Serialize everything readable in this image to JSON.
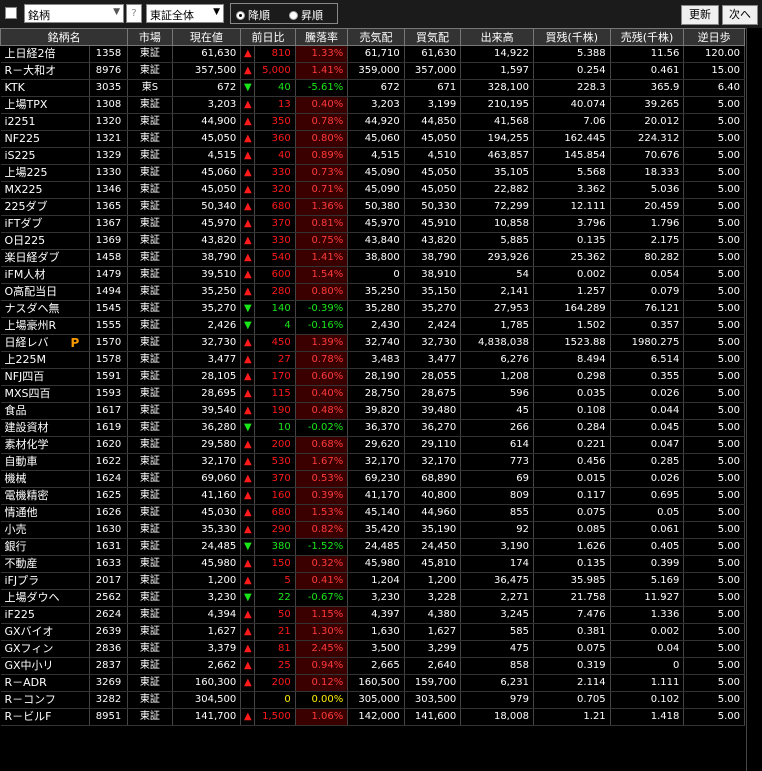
{
  "toolbar": {
    "combo_label": "銘柄",
    "help": "?",
    "market_filter": "東証全体",
    "radio_desc": "降順",
    "radio_asc": "昇順",
    "refresh": "更新",
    "next": "次へ"
  },
  "columns": [
    "銘柄名",
    "市場",
    "現在値",
    "前日比",
    "騰落率",
    "売気配",
    "買気配",
    "出来高",
    "買残(千株)",
    "売残(千株)",
    "逆日歩"
  ],
  "rows": [
    {
      "name": "上日経2倍",
      "code": "1358",
      "market": "東証",
      "price": "61,630",
      "dir": "up",
      "change": "810",
      "pct": "1.33%",
      "ask": "61,710",
      "bid": "61,630",
      "volume": "14,922",
      "buy": "5.388",
      "sell": "11.56",
      "rev": "120.00"
    },
    {
      "name": "R－大和オ",
      "code": "8976",
      "market": "東証",
      "price": "357,500",
      "dir": "up",
      "change": "5,000",
      "pct": "1.41%",
      "ask": "359,000",
      "bid": "357,000",
      "volume": "1,597",
      "buy": "0.254",
      "sell": "0.461",
      "rev": "15.00"
    },
    {
      "name": "KTK",
      "code": "3035",
      "market": "東S",
      "price": "672",
      "dir": "dn",
      "change": "40",
      "pct": "-5.61%",
      "ask": "672",
      "bid": "671",
      "volume": "328,100",
      "buy": "228.3",
      "sell": "365.9",
      "rev": "6.40"
    },
    {
      "name": "上場TPX",
      "code": "1308",
      "market": "東証",
      "price": "3,203",
      "dir": "up",
      "change": "13",
      "pct": "0.40%",
      "ask": "3,203",
      "bid": "3,199",
      "volume": "210,195",
      "buy": "40.074",
      "sell": "39.265",
      "rev": "5.00"
    },
    {
      "name": "i2251",
      "code": "1320",
      "market": "東証",
      "price": "44,900",
      "dir": "up",
      "change": "350",
      "pct": "0.78%",
      "ask": "44,920",
      "bid": "44,850",
      "volume": "41,568",
      "buy": "7.06",
      "sell": "20.012",
      "rev": "5.00"
    },
    {
      "name": "NF225",
      "code": "1321",
      "market": "東証",
      "price": "45,050",
      "dir": "up",
      "change": "360",
      "pct": "0.80%",
      "ask": "45,060",
      "bid": "45,050",
      "volume": "194,255",
      "buy": "162.445",
      "sell": "224.312",
      "rev": "5.00"
    },
    {
      "name": "iS225",
      "code": "1329",
      "market": "東証",
      "price": "4,515",
      "dir": "up",
      "change": "40",
      "pct": "0.89%",
      "ask": "4,515",
      "bid": "4,510",
      "volume": "463,857",
      "buy": "145.854",
      "sell": "70.676",
      "rev": "5.00"
    },
    {
      "name": "上場225",
      "code": "1330",
      "market": "東証",
      "price": "45,060",
      "dir": "up",
      "change": "330",
      "pct": "0.73%",
      "ask": "45,090",
      "bid": "45,050",
      "volume": "35,105",
      "buy": "5.568",
      "sell": "18.333",
      "rev": "5.00"
    },
    {
      "name": "MX225",
      "code": "1346",
      "market": "東証",
      "price": "45,050",
      "dir": "up",
      "change": "320",
      "pct": "0.71%",
      "ask": "45,090",
      "bid": "45,050",
      "volume": "22,882",
      "buy": "3.362",
      "sell": "5.036",
      "rev": "5.00"
    },
    {
      "name": "225ダブ",
      "code": "1365",
      "market": "東証",
      "price": "50,340",
      "dir": "up",
      "change": "680",
      "pct": "1.36%",
      "ask": "50,380",
      "bid": "50,330",
      "volume": "72,299",
      "buy": "12.111",
      "sell": "20.459",
      "rev": "5.00"
    },
    {
      "name": "iFTダブ",
      "code": "1367",
      "market": "東証",
      "price": "45,970",
      "dir": "up",
      "change": "370",
      "pct": "0.81%",
      "ask": "45,970",
      "bid": "45,910",
      "volume": "10,858",
      "buy": "3.796",
      "sell": "1.796",
      "rev": "5.00"
    },
    {
      "name": "O日225",
      "code": "1369",
      "market": "東証",
      "price": "43,820",
      "dir": "up",
      "change": "330",
      "pct": "0.75%",
      "ask": "43,840",
      "bid": "43,820",
      "volume": "5,885",
      "buy": "0.135",
      "sell": "2.175",
      "rev": "5.00"
    },
    {
      "name": "楽日経ダブ",
      "code": "1458",
      "market": "東証",
      "price": "38,790",
      "dir": "up",
      "change": "540",
      "pct": "1.41%",
      "ask": "38,800",
      "bid": "38,790",
      "volume": "293,926",
      "buy": "25.362",
      "sell": "80.282",
      "rev": "5.00"
    },
    {
      "name": "iFM人材",
      "code": "1479",
      "market": "東証",
      "price": "39,510",
      "dir": "up",
      "change": "600",
      "pct": "1.54%",
      "ask": "0",
      "bid": "38,910",
      "volume": "54",
      "buy": "0.002",
      "sell": "0.054",
      "rev": "5.00"
    },
    {
      "name": "O高配当日",
      "code": "1494",
      "market": "東証",
      "price": "35,250",
      "dir": "up",
      "change": "280",
      "pct": "0.80%",
      "ask": "35,250",
      "bid": "35,150",
      "volume": "2,141",
      "buy": "1.257",
      "sell": "0.079",
      "rev": "5.00"
    },
    {
      "name": "ナスダヘ無",
      "code": "1545",
      "market": "東証",
      "price": "35,270",
      "dir": "dn",
      "change": "140",
      "pct": "-0.39%",
      "ask": "35,280",
      "bid": "35,270",
      "volume": "27,953",
      "buy": "164.289",
      "sell": "76.121",
      "rev": "5.00"
    },
    {
      "name": "上場豪州R",
      "code": "1555",
      "market": "東証",
      "price": "2,426",
      "dir": "dn",
      "change": "4",
      "pct": "-0.16%",
      "ask": "2,430",
      "bid": "2,424",
      "volume": "1,785",
      "buy": "1.502",
      "sell": "0.357",
      "rev": "5.00"
    },
    {
      "name": "日経レバ",
      "code": "1570",
      "market": "東証",
      "price": "32,730",
      "dir": "up",
      "change": "450",
      "pct": "1.39%",
      "ask": "32,740",
      "bid": "32,730",
      "volume": "4,838,038",
      "buy": "1523.88",
      "sell": "1980.275",
      "rev": "5.00",
      "mark": "P"
    },
    {
      "name": "上225M",
      "code": "1578",
      "market": "東証",
      "price": "3,477",
      "dir": "up",
      "change": "27",
      "pct": "0.78%",
      "ask": "3,483",
      "bid": "3,477",
      "volume": "6,276",
      "buy": "8.494",
      "sell": "6.514",
      "rev": "5.00"
    },
    {
      "name": "NFJ四百",
      "code": "1591",
      "market": "東証",
      "price": "28,105",
      "dir": "up",
      "change": "170",
      "pct": "0.60%",
      "ask": "28,190",
      "bid": "28,055",
      "volume": "1,208",
      "buy": "0.298",
      "sell": "0.355",
      "rev": "5.00"
    },
    {
      "name": "MXS四百",
      "code": "1593",
      "market": "東証",
      "price": "28,695",
      "dir": "up",
      "change": "115",
      "pct": "0.40%",
      "ask": "28,750",
      "bid": "28,675",
      "volume": "596",
      "buy": "0.035",
      "sell": "0.026",
      "rev": "5.00"
    },
    {
      "name": "食品",
      "code": "1617",
      "market": "東証",
      "price": "39,540",
      "dir": "up",
      "change": "190",
      "pct": "0.48%",
      "ask": "39,820",
      "bid": "39,480",
      "volume": "45",
      "buy": "0.108",
      "sell": "0.044",
      "rev": "5.00"
    },
    {
      "name": "建設資材",
      "code": "1619",
      "market": "東証",
      "price": "36,280",
      "dir": "dn",
      "change": "10",
      "pct": "-0.02%",
      "ask": "36,370",
      "bid": "36,270",
      "volume": "266",
      "buy": "0.284",
      "sell": "0.045",
      "rev": "5.00"
    },
    {
      "name": "素材化学",
      "code": "1620",
      "market": "東証",
      "price": "29,580",
      "dir": "up",
      "change": "200",
      "pct": "0.68%",
      "ask": "29,620",
      "bid": "29,110",
      "volume": "614",
      "buy": "0.221",
      "sell": "0.047",
      "rev": "5.00"
    },
    {
      "name": "自動車",
      "code": "1622",
      "market": "東証",
      "price": "32,170",
      "dir": "up",
      "change": "530",
      "pct": "1.67%",
      "ask": "32,170",
      "bid": "32,170",
      "volume": "773",
      "buy": "0.456",
      "sell": "0.285",
      "rev": "5.00"
    },
    {
      "name": "機械",
      "code": "1624",
      "market": "東証",
      "price": "69,060",
      "dir": "up",
      "change": "370",
      "pct": "0.53%",
      "ask": "69,230",
      "bid": "68,890",
      "volume": "69",
      "buy": "0.015",
      "sell": "0.026",
      "rev": "5.00"
    },
    {
      "name": "電機精密",
      "code": "1625",
      "market": "東証",
      "price": "41,160",
      "dir": "up",
      "change": "160",
      "pct": "0.39%",
      "ask": "41,170",
      "bid": "40,800",
      "volume": "809",
      "buy": "0.117",
      "sell": "0.695",
      "rev": "5.00"
    },
    {
      "name": "情通他",
      "code": "1626",
      "market": "東証",
      "price": "45,030",
      "dir": "up",
      "change": "680",
      "pct": "1.53%",
      "ask": "45,140",
      "bid": "44,960",
      "volume": "855",
      "buy": "0.075",
      "sell": "0.05",
      "rev": "5.00"
    },
    {
      "name": "小売",
      "code": "1630",
      "market": "東証",
      "price": "35,330",
      "dir": "up",
      "change": "290",
      "pct": "0.82%",
      "ask": "35,420",
      "bid": "35,190",
      "volume": "92",
      "buy": "0.085",
      "sell": "0.061",
      "rev": "5.00"
    },
    {
      "name": "銀行",
      "code": "1631",
      "market": "東証",
      "price": "24,485",
      "dir": "dn",
      "change": "380",
      "pct": "-1.52%",
      "ask": "24,485",
      "bid": "24,450",
      "volume": "3,190",
      "buy": "1.626",
      "sell": "0.405",
      "rev": "5.00"
    },
    {
      "name": "不動産",
      "code": "1633",
      "market": "東証",
      "price": "45,980",
      "dir": "up",
      "change": "150",
      "pct": "0.32%",
      "ask": "45,980",
      "bid": "45,810",
      "volume": "174",
      "buy": "0.135",
      "sell": "0.399",
      "rev": "5.00"
    },
    {
      "name": "iFJプラ",
      "code": "2017",
      "market": "東証",
      "price": "1,200",
      "dir": "up",
      "change": "5",
      "pct": "0.41%",
      "ask": "1,204",
      "bid": "1,200",
      "volume": "36,475",
      "buy": "35.985",
      "sell": "5.169",
      "rev": "5.00"
    },
    {
      "name": "上場ダウヘ",
      "code": "2562",
      "market": "東証",
      "price": "3,230",
      "dir": "dn",
      "change": "22",
      "pct": "-0.67%",
      "ask": "3,230",
      "bid": "3,228",
      "volume": "2,271",
      "buy": "21.758",
      "sell": "11.927",
      "rev": "5.00"
    },
    {
      "name": "iF225",
      "code": "2624",
      "market": "東証",
      "price": "4,394",
      "dir": "up",
      "change": "50",
      "pct": "1.15%",
      "ask": "4,397",
      "bid": "4,380",
      "volume": "3,245",
      "buy": "7.476",
      "sell": "1.336",
      "rev": "5.00"
    },
    {
      "name": "GXバイオ",
      "code": "2639",
      "market": "東証",
      "price": "1,627",
      "dir": "up",
      "change": "21",
      "pct": "1.30%",
      "ask": "1,630",
      "bid": "1,627",
      "volume": "585",
      "buy": "0.381",
      "sell": "0.002",
      "rev": "5.00"
    },
    {
      "name": "GXフィン",
      "code": "2836",
      "market": "東証",
      "price": "3,379",
      "dir": "up",
      "change": "81",
      "pct": "2.45%",
      "ask": "3,500",
      "bid": "3,299",
      "volume": "475",
      "buy": "0.075",
      "sell": "0.04",
      "rev": "5.00"
    },
    {
      "name": "GX中小リ",
      "code": "2837",
      "market": "東証",
      "price": "2,662",
      "dir": "up",
      "change": "25",
      "pct": "0.94%",
      "ask": "2,665",
      "bid": "2,640",
      "volume": "858",
      "buy": "0.319",
      "sell": "0",
      "rev": "5.00"
    },
    {
      "name": "R－ADR",
      "code": "3269",
      "market": "東証",
      "price": "160,300",
      "dir": "up",
      "change": "200",
      "pct": "0.12%",
      "ask": "160,500",
      "bid": "159,700",
      "volume": "6,231",
      "buy": "2.114",
      "sell": "1.111",
      "rev": "5.00"
    },
    {
      "name": "R－コンフ",
      "code": "3282",
      "market": "東証",
      "price": "304,500",
      "dir": "flat",
      "change": "0",
      "pct": "0.00%",
      "ask": "305,000",
      "bid": "303,500",
      "volume": "979",
      "buy": "0.705",
      "sol": "",
      "sell": "0.102",
      "rev": "5.00"
    },
    {
      "name": "R－ビルF",
      "code": "8951",
      "market": "東証",
      "price": "141,700",
      "dir": "up",
      "change": "1,500",
      "pct": "1.06%",
      "ask": "142,000",
      "bid": "141,600",
      "volume": "18,008",
      "buy": "1.21",
      "sell": "1.418",
      "rev": "5.00"
    }
  ]
}
